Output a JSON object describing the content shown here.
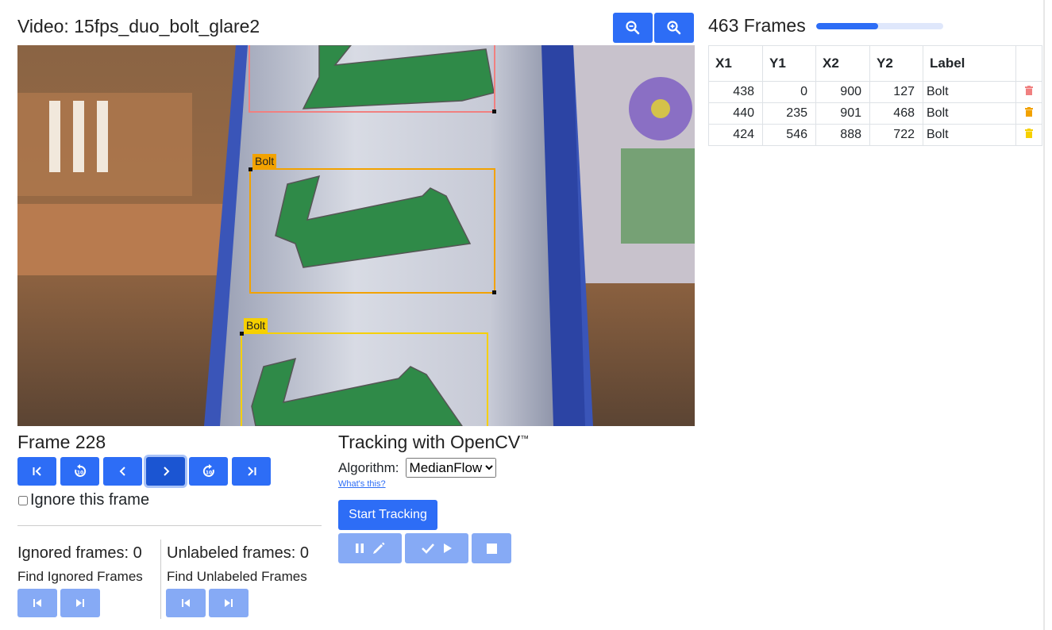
{
  "video": {
    "title": "Video: 15fps_duo_bolt_glare2"
  },
  "toolbar": {
    "zoom_out_icon": "zoom-out-icon",
    "zoom_in_icon": "zoom-in-icon"
  },
  "frames": {
    "count_label": "463 Frames",
    "progress": 0.49
  },
  "viewport": {
    "boxes": [
      {
        "label": "Bolt",
        "color": "#f08080"
      },
      {
        "label": "Bolt",
        "color": "#f2a200"
      },
      {
        "label": "Bolt",
        "color": "#f6d000"
      }
    ]
  },
  "table": {
    "headers": [
      "X1",
      "Y1",
      "X2",
      "Y2",
      "Label",
      ""
    ],
    "rows": [
      {
        "x1": "438",
        "y1": "0",
        "x2": "900",
        "y2": "127",
        "label": "Bolt",
        "trash_color": "#f08080"
      },
      {
        "x1": "440",
        "y1": "235",
        "x2": "901",
        "y2": "468",
        "label": "Bolt",
        "trash_color": "#f2a200"
      },
      {
        "x1": "424",
        "y1": "546",
        "x2": "888",
        "y2": "722",
        "label": "Bolt",
        "trash_color": "#f6d000"
      }
    ]
  },
  "navigation": {
    "frame_label": "Frame 228",
    "ignore_label": "Ignore this frame",
    "ignore_checked": false
  },
  "ignored": {
    "title": "Ignored frames: 0",
    "find_label": "Find Ignored Frames"
  },
  "unlabeled": {
    "title": "Unlabeled frames: 0",
    "find_label": "Find Unlabeled Frames"
  },
  "tracking": {
    "title": "Tracking with OpenCV",
    "trademark": "™",
    "algorithm_label": "Algorithm:",
    "algorithm_value": "MedianFlow",
    "whats_this": "What's this?",
    "start_label": "Start Tracking"
  },
  "colors": {
    "accent": "#2d6df6",
    "accent_light": "#86aaf5"
  }
}
